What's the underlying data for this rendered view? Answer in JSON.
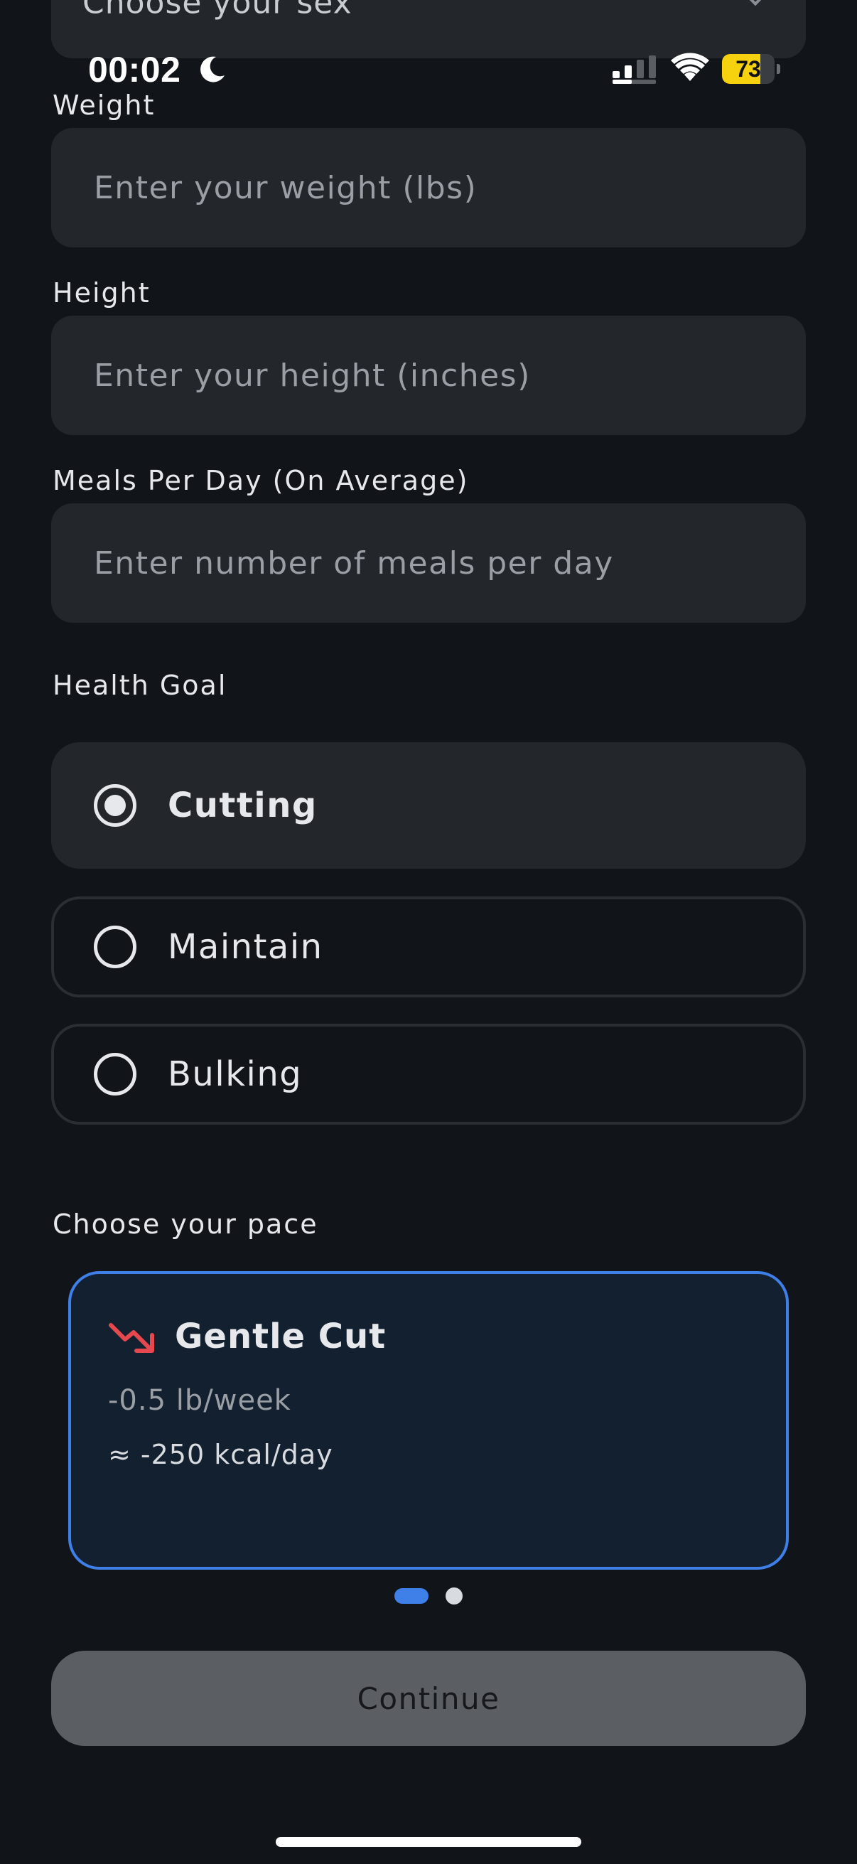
{
  "status_bar": {
    "time": "00:02",
    "focus_icon": "moon-icon",
    "signal_icon": "cellular-signal-icon",
    "wifi_icon": "wifi-icon",
    "battery_level": "73",
    "battery_color": "#f6d20e"
  },
  "sex_select": {
    "value": "Choose your sex"
  },
  "form": {
    "weight": {
      "label": "Weight",
      "placeholder": "Enter your weight (lbs)"
    },
    "height": {
      "label": "Height",
      "placeholder": "Enter your height (inches)"
    },
    "meals": {
      "label": "Meals Per Day (On Average)",
      "placeholder": "Enter number of meals per day"
    }
  },
  "health_goal": {
    "label": "Health Goal",
    "selected": "Cutting",
    "options": [
      {
        "label": "Cutting"
      },
      {
        "label": "Maintain"
      },
      {
        "label": "Bulking"
      }
    ]
  },
  "pace": {
    "label": "Choose your pace",
    "card": {
      "icon": "trending-down-icon",
      "icon_color": "#e5484d",
      "title": "Gentle Cut",
      "rate": "-0.5 lb/week",
      "kcal": "≈ -250 kcal/day"
    },
    "page_count": 2,
    "active_page": 1,
    "accent_color": "#3f7fe8"
  },
  "continue_button": {
    "label": "Continue"
  }
}
